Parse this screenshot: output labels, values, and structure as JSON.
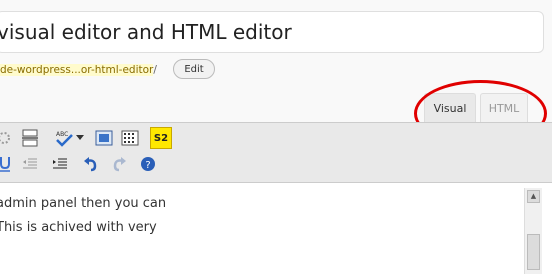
{
  "post": {
    "title": "visual editor and HTML editor"
  },
  "permalink": {
    "slug": "de-wordpress...or-html-editor",
    "trailing": "/",
    "edit_label": "Edit"
  },
  "editor_tabs": {
    "visual_label": "Visual",
    "html_label": "HTML"
  },
  "toolbar": {
    "spellcheck_label": "ABC",
    "kitchen_sink_label": "S2"
  },
  "content": {
    "lines": [
      "admin panel then you can",
      "This is achived with very"
    ]
  },
  "colors": {
    "annotation_circle": "#e00000",
    "kitchen_sink_bg": "#ffe800",
    "slug_highlight": "#fffbcc"
  }
}
